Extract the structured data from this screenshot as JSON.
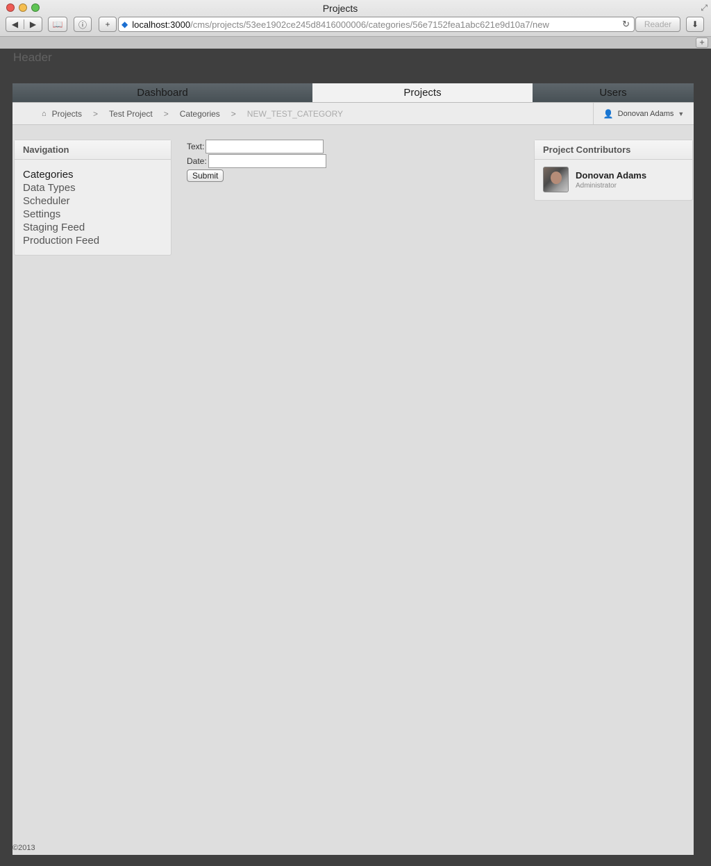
{
  "window": {
    "title": "Projects",
    "reader_label": "Reader"
  },
  "address": {
    "host": "localhost:3000",
    "path": "/cms/projects/53ee1902ce245d8416000006/categories/56e7152fea1abc621e9d10a7/new"
  },
  "page": {
    "header": "Header",
    "footer": "©2013"
  },
  "mainnav": [
    {
      "label": "Dashboard"
    },
    {
      "label": "Projects"
    },
    {
      "label": "Users"
    }
  ],
  "breadcrumb": [
    {
      "label": "Projects"
    },
    {
      "label": "Test Project"
    },
    {
      "label": "Categories"
    },
    {
      "label": "NEW_TEST_CATEGORY"
    }
  ],
  "user": {
    "name": "Donovan Adams"
  },
  "navigation": {
    "title": "Navigation",
    "items": [
      {
        "label": "Categories"
      },
      {
        "label": "Data Types"
      },
      {
        "label": "Scheduler"
      },
      {
        "label": "Settings"
      },
      {
        "label": "Staging Feed"
      },
      {
        "label": "Production Feed"
      }
    ]
  },
  "form": {
    "text_label": "Text:",
    "text_value": "",
    "date_label": "Date:",
    "date_value": "",
    "submit_label": "Submit"
  },
  "contributors": {
    "title": "Project Contributors",
    "items": [
      {
        "name": "Donovan Adams",
        "role": "Administrator"
      }
    ]
  },
  "icons": {
    "home": "home-icon",
    "user": "user-icon",
    "caret": "chevron-down-icon",
    "reload": "reload-icon",
    "download": "download-icon"
  }
}
